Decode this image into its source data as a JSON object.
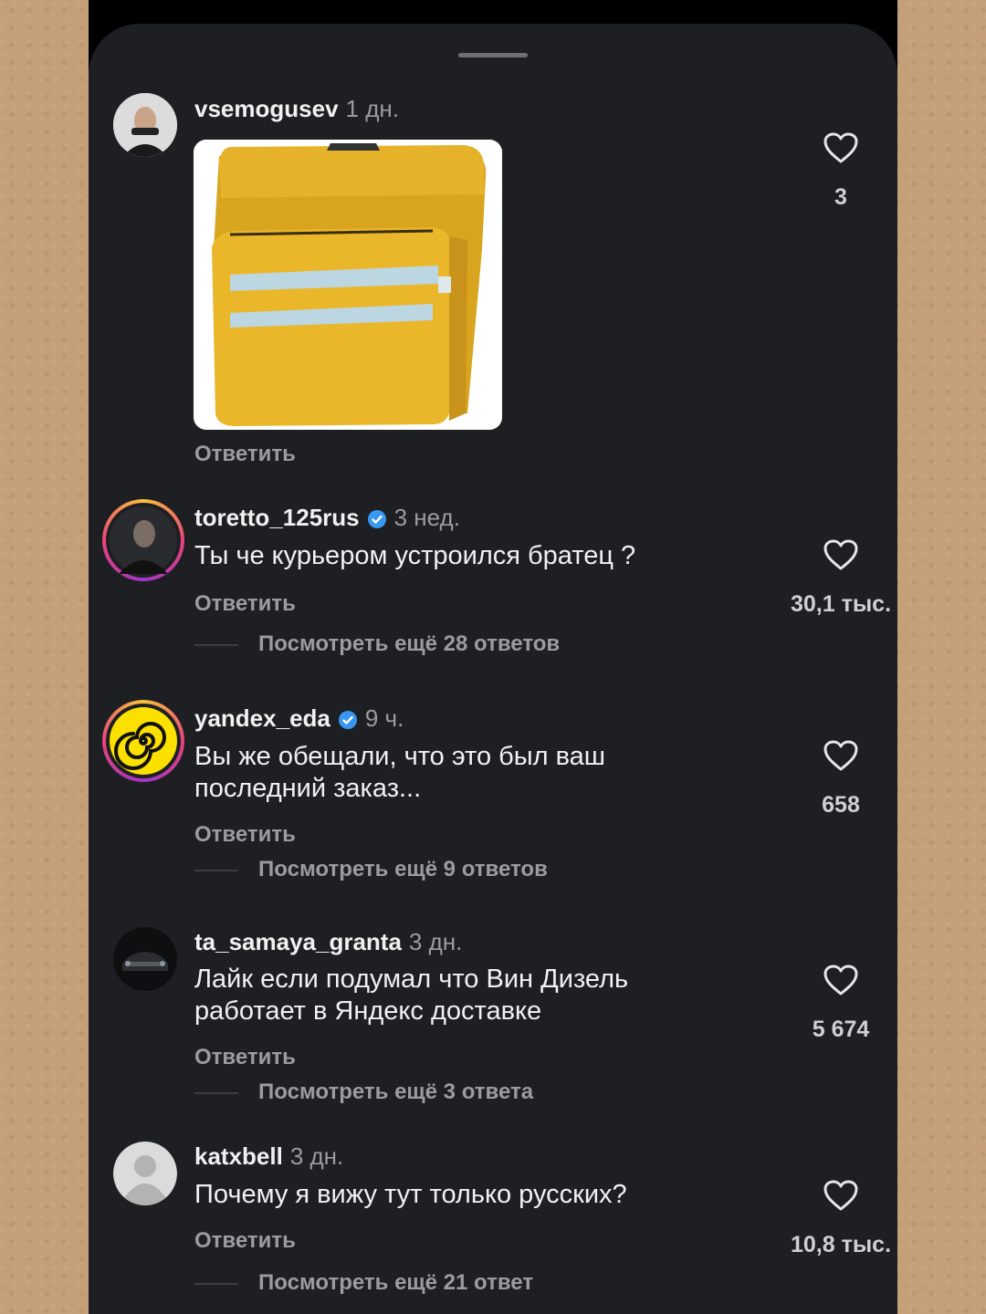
{
  "comments": [
    {
      "username": "vsemogusev",
      "time": "1 дн.",
      "text": "",
      "reply": "Ответить",
      "likes": "3",
      "more": ""
    },
    {
      "username": "toretto_125rus",
      "time": "3 нед.",
      "text": "Ты че курьером устроился братец ?",
      "reply": "Ответить",
      "likes": "30,1 тыс.",
      "more": "Посмотреть ещё 28 ответов"
    },
    {
      "username": "yandex_eda",
      "time": "9 ч.",
      "text": "Вы же обещали, что это был ваш последний заказ...",
      "reply": "Ответить",
      "likes": "658",
      "more": "Посмотреть ещё 9 ответов"
    },
    {
      "username": "ta_samaya_granta",
      "time": "3 дн.",
      "text": "Лайк если подумал что Вин Дизель работает в Яндекс доставке",
      "reply": "Ответить",
      "likes": "5 674",
      "more": "Посмотреть ещё 3 ответа"
    },
    {
      "username": "katxbell",
      "time": "3 дн.",
      "text": "Почему я вижу тут только русских?",
      "reply": "Ответить",
      "likes": "10,8 тыс.",
      "more": "Посмотреть ещё 21 ответ"
    }
  ],
  "colors": {
    "background": "#1e1f23",
    "text": "#f1f1f1",
    "muted": "#9a9ca1",
    "verified": "#3897f0",
    "backpack": "#e8b62a"
  },
  "icons": [
    "heart-icon",
    "verified-badge-icon",
    "avatar-icon",
    "drag-handle-icon"
  ]
}
